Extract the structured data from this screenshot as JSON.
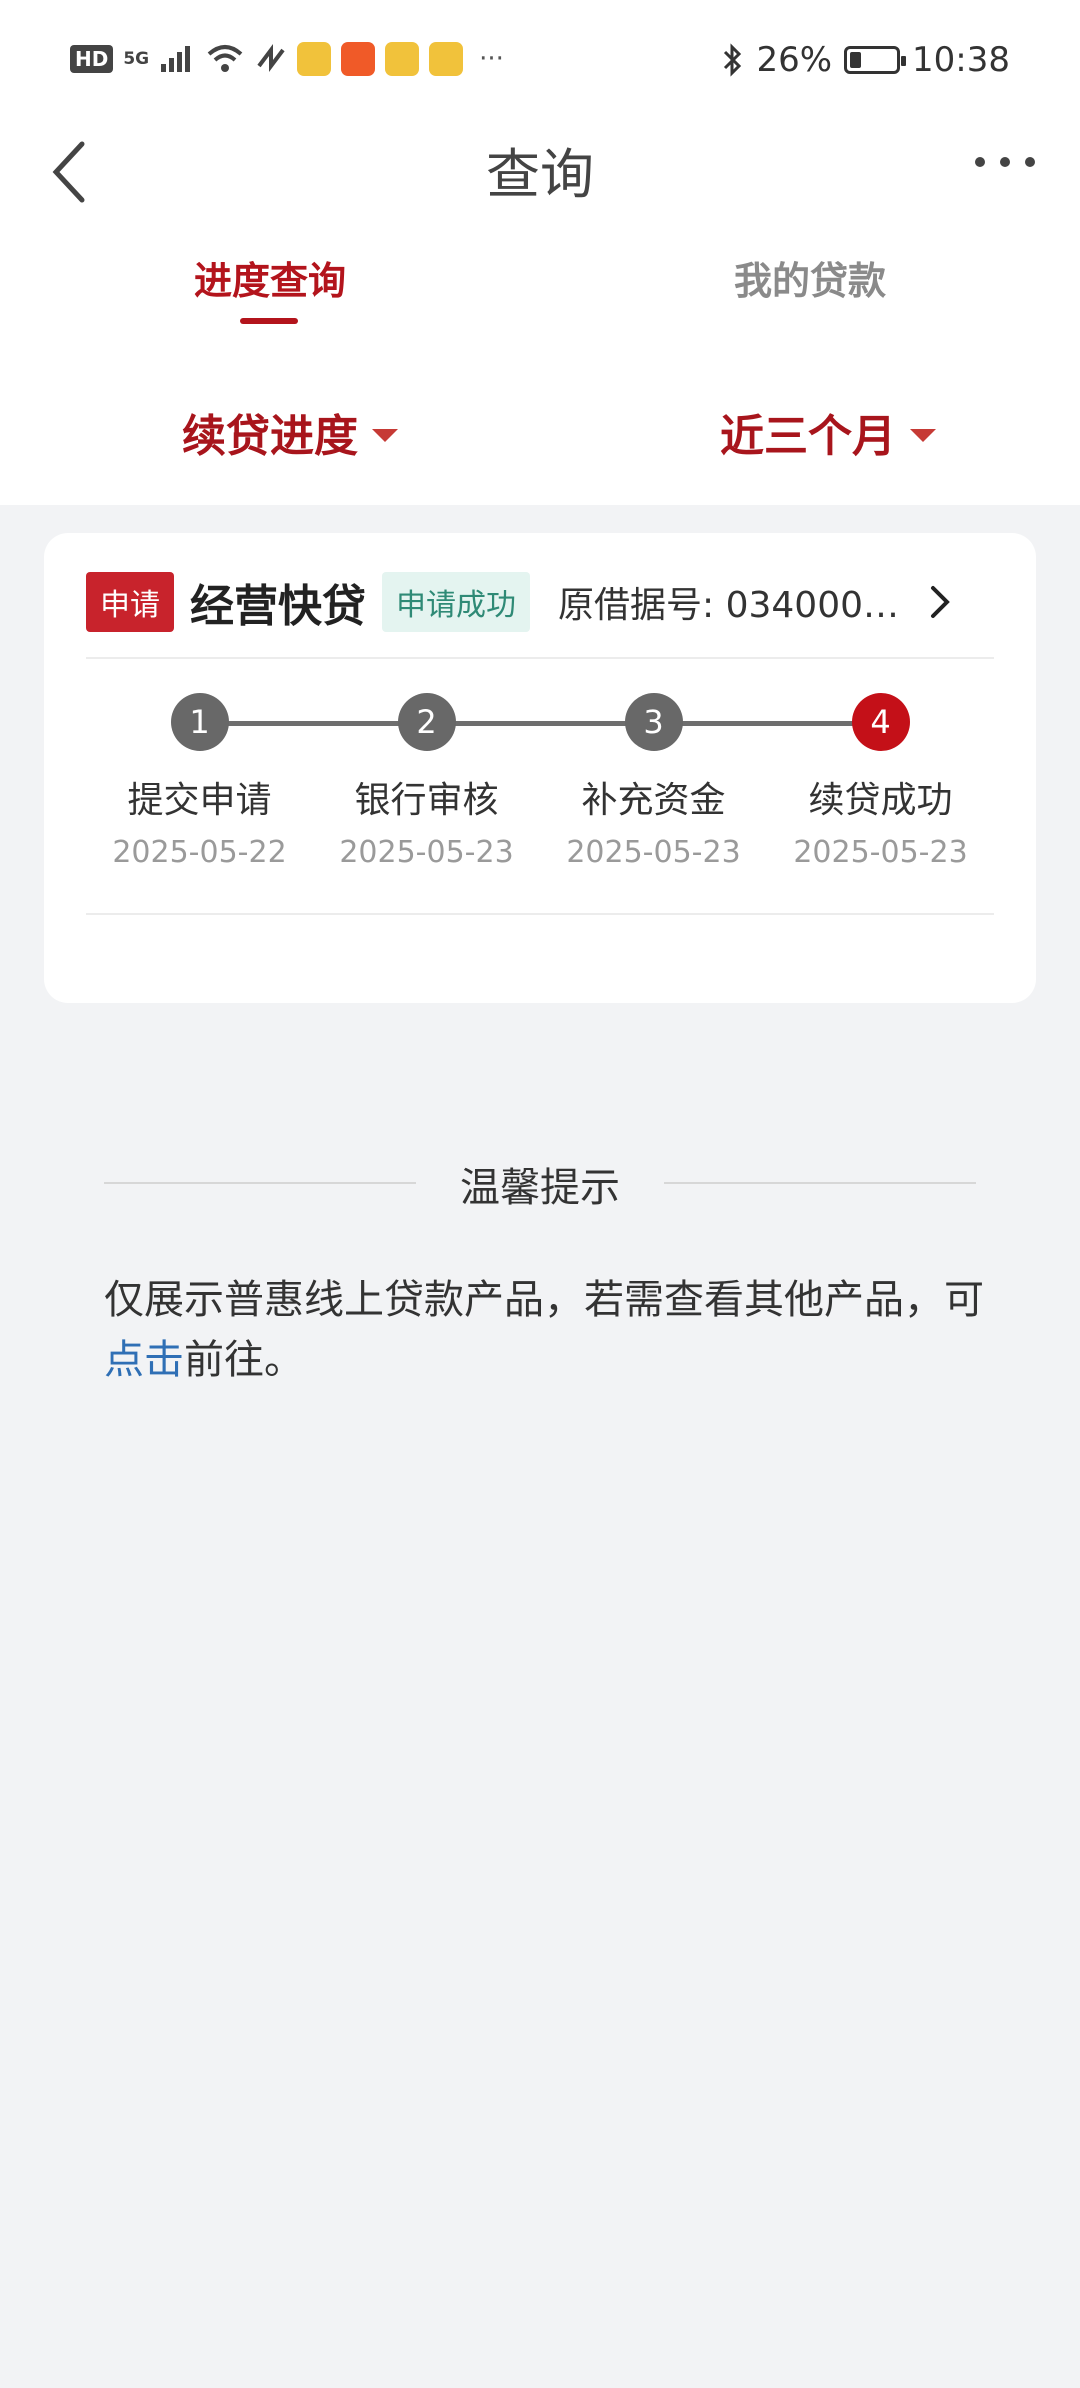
{
  "status_bar": {
    "time": "10:38",
    "battery_text": "26%",
    "battery_level": 0.26,
    "network": "5G",
    "hd_label": "HD",
    "more": "···",
    "accent_app_colors": [
      "#f1c23b",
      "#f05a28",
      "#f1c23b",
      "#f1c23b"
    ]
  },
  "nav": {
    "title": "查询"
  },
  "tabs": [
    {
      "label": "进度查询",
      "active": true
    },
    {
      "label": "我的贷款",
      "active": false
    }
  ],
  "filters": {
    "type": "续贷进度",
    "period": "近三个月"
  },
  "card": {
    "tag": "申请",
    "product": "经营快贷",
    "status": "申请成功",
    "original_no": "原借据号: 0340000...",
    "steps": [
      {
        "num": "1",
        "label": "提交申请",
        "date": "2025-05-22"
      },
      {
        "num": "2",
        "label": "银行审核",
        "date": "2025-05-23"
      },
      {
        "num": "3",
        "label": "补充资金",
        "date": "2025-05-23"
      },
      {
        "num": "4",
        "label": "续贷成功",
        "date": "2025-05-23"
      }
    ]
  },
  "tip": {
    "title": "温馨提示",
    "text_before": "仅展示普惠线上贷款产品，若需查看其他产品，可",
    "link": "点击",
    "text_after": "前往。"
  },
  "colors": {
    "brand_red": "#b3141c",
    "success_green": "#2f8a76",
    "link_blue": "#2f6fb5"
  }
}
